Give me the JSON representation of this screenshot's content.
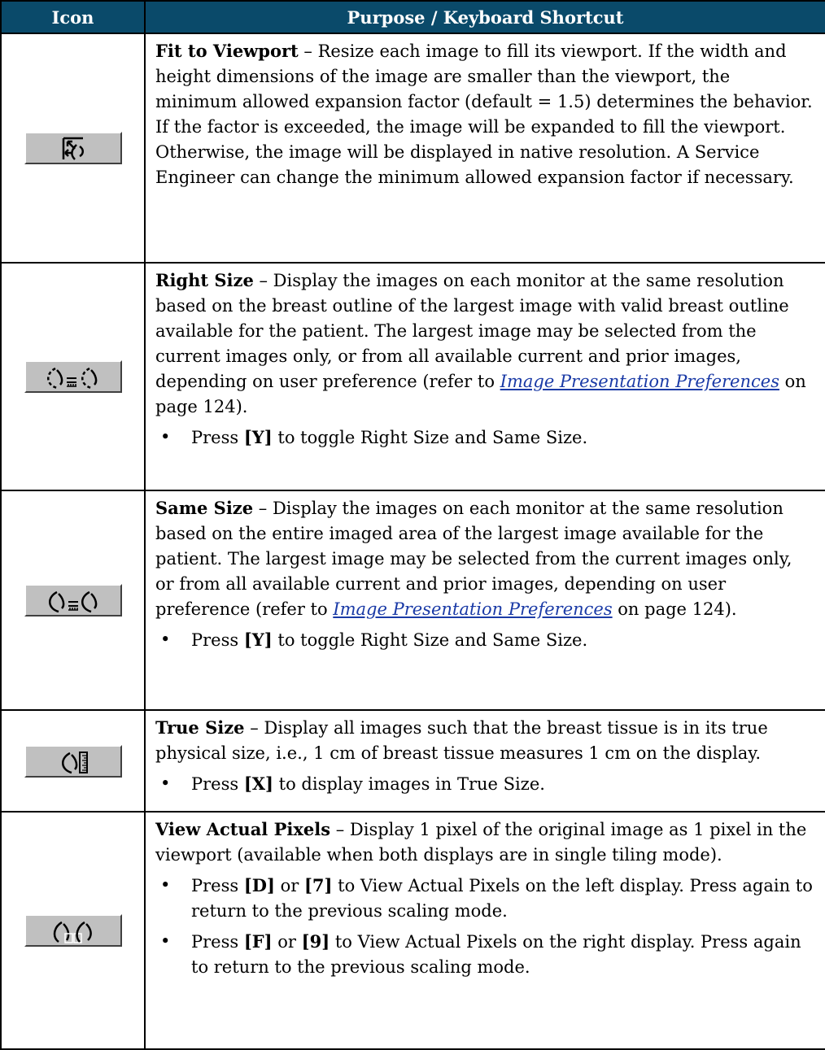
{
  "headers": {
    "icon": "Icon",
    "purpose": "Purpose / Keyboard Shortcut"
  },
  "rows": [
    {
      "icon": "fit-to-viewport-icon",
      "title": "Fit to Viewport",
      "description": " – Resize each image to fill its viewport. If the width and height dimensions of the image are smaller than the viewport, the minimum allowed expansion factor (default = 1.5) determines the behavior. If the factor is exceeded, the image will be expanded to fill the viewport. Otherwise, the image will be displayed in native resolution. A Service Engineer can change the minimum allowed expansion factor if necessary."
    },
    {
      "icon": "right-size-icon",
      "title": "Right Size",
      "description": " – Display the images on each monitor at the same resolution based on the breast outline of the largest image with valid breast outline available for the patient. The largest image may be selected from the current images only, or from all available current and prior images, depending on user preference (refer to ",
      "link": "Image Presentation Preferences",
      "after_link": " on page 124).",
      "bullets": [
        {
          "pre": "Press ",
          "key": "[Y]",
          "post": " to toggle Right Size and Same Size."
        }
      ]
    },
    {
      "icon": "same-size-icon",
      "title": "Same Size",
      "description": " – Display the images on each monitor at the same resolution based on the entire imaged area of the largest image available for the patient. The largest image may be selected from the current images only, or from all available current and prior images, depending on user preference (refer to ",
      "link": "Image Presentation Preferences",
      "after_link": " on page 124).",
      "bullets": [
        {
          "pre": "Press ",
          "key": "[Y]",
          "post": " to toggle Right Size and Same Size."
        }
      ]
    },
    {
      "icon": "true-size-icon",
      "title": "True Size",
      "description": " – Display all images such that the breast tissue is in its true physical size, i.e., 1 cm of breast tissue measures 1 cm on the display.",
      "bullets": [
        {
          "pre": "Press ",
          "key": "[X]",
          "post": " to display images in True Size."
        }
      ]
    },
    {
      "icon": "view-actual-pixels-icon",
      "title": "View Actual Pixels",
      "description": " – Display 1 pixel of the original image as 1 pixel in the viewport (available when both displays are in single tiling mode).",
      "bullets": [
        {
          "pre": "Press ",
          "key": "[D]",
          "mid": " or ",
          "key2": "[7]",
          "post": " to View Actual Pixels on the left display. Press again to return to the previous scaling mode."
        },
        {
          "pre": "Press ",
          "key": "[F]",
          "mid": " or ",
          "key2": "[9]",
          "post": " to View Actual Pixels on the right display. Press again to return to the previous scaling mode."
        }
      ]
    }
  ]
}
